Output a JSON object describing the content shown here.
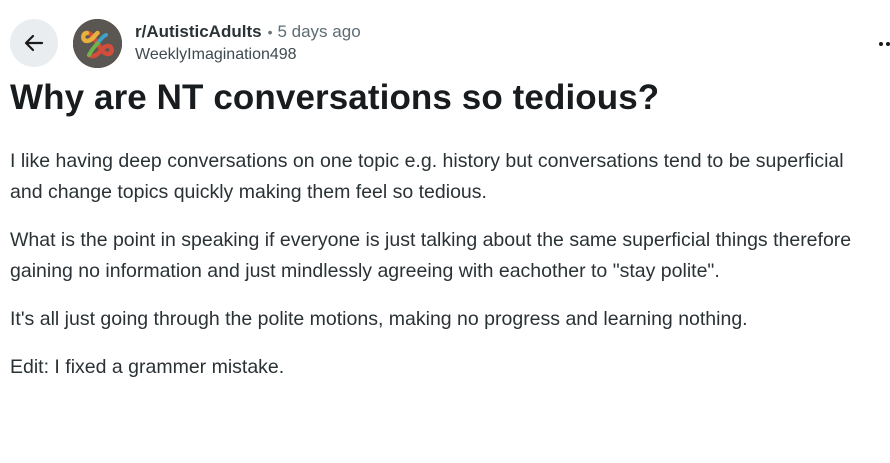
{
  "post": {
    "subreddit": "r/AutisticAdults",
    "separator": "•",
    "time_ago": "5 days ago",
    "author": "WeeklyImagination498",
    "title": "Why are NT conversations so tedious?",
    "paragraphs": [
      "I like having deep conversations on one topic e.g. history but conversations tend to be superficial and change topics quickly making them feel so tedious.",
      "What is the point in speaking if everyone is just talking about the same superficial things therefore gaining no information and just mindlessly agreeing with eachother to \"stay polite\".",
      "It's all just going through the polite motions, making no progress and learning nothing.",
      "Edit: I fixed a grammer mistake."
    ]
  },
  "icons": {
    "back": "arrow-left-icon",
    "more": "more-options-icon",
    "avatar": "subreddit-avatar"
  },
  "colors": {
    "back_button_bg": "#e9edef",
    "text_primary": "#181c1f",
    "text_body": "#2a3236",
    "text_meta": "#5c6c74"
  }
}
